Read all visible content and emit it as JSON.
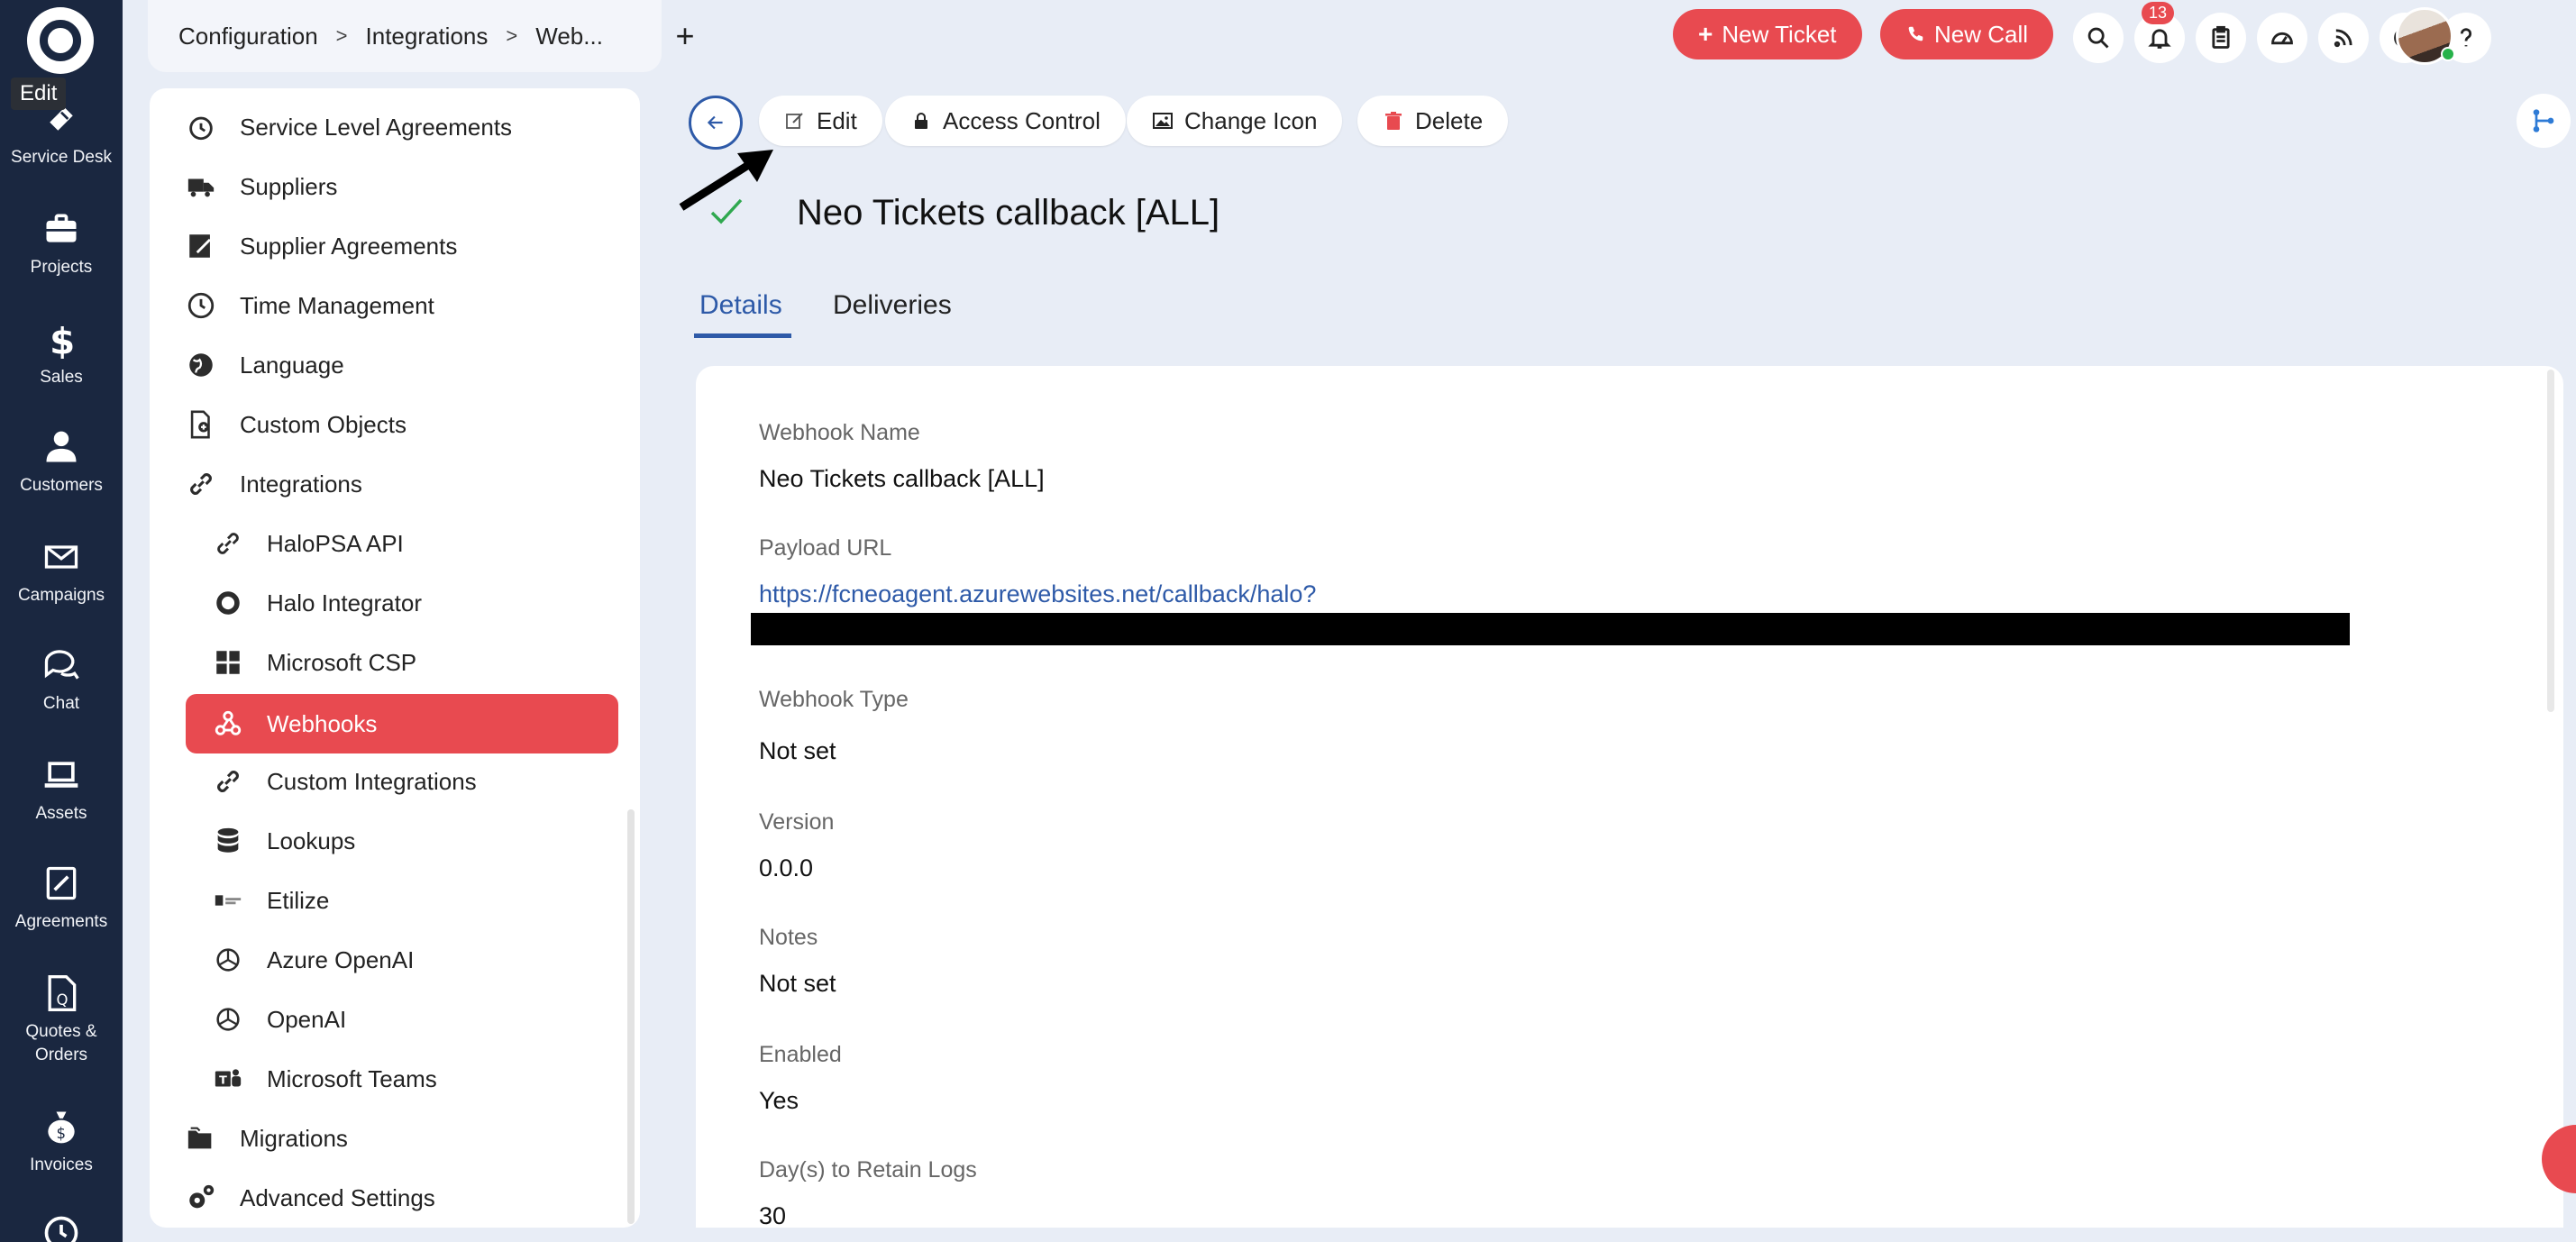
{
  "rail": {
    "tooltip": "Edit",
    "items": [
      {
        "label": "Service Desk",
        "icon": "ticket-icon"
      },
      {
        "label": "Projects",
        "icon": "briefcase-icon"
      },
      {
        "label": "Sales",
        "icon": "dollar-icon"
      },
      {
        "label": "Customers",
        "icon": "person-icon"
      },
      {
        "label": "Campaigns",
        "icon": "envelope-icon"
      },
      {
        "label": "Chat",
        "icon": "chat-bubbles-icon"
      },
      {
        "label": "Assets",
        "icon": "laptop-icon"
      },
      {
        "label": "Agreements",
        "icon": "signed-document-icon"
      },
      {
        "label": "Quotes &",
        "label2": "Orders",
        "icon": "quote-document-icon"
      },
      {
        "label": "Invoices",
        "icon": "money-bag-icon"
      }
    ]
  },
  "breadcrumb": {
    "items": [
      "Configuration",
      "Integrations",
      "Web..."
    ],
    "separator": ">"
  },
  "topbar": {
    "new_tab": "+",
    "new_ticket": "New Ticket",
    "new_call": "New Call",
    "notification_count": "13",
    "accent": "#e84a50"
  },
  "sidebar": {
    "items": [
      {
        "label": "Service Level Agreements",
        "icon": "timer-icon"
      },
      {
        "label": "Suppliers",
        "icon": "truck-icon"
      },
      {
        "label": "Supplier Agreements",
        "icon": "edit-document-icon"
      },
      {
        "label": "Time Management",
        "icon": "clock-icon"
      },
      {
        "label": "Language",
        "icon": "globe-icon"
      },
      {
        "label": "Custom Objects",
        "icon": "document-plus-icon"
      },
      {
        "label": "Integrations",
        "icon": "link-icon"
      },
      {
        "label": "HaloPSA API",
        "icon": "api-link-icon"
      },
      {
        "label": "Halo Integrator",
        "icon": "halo-ring-icon"
      },
      {
        "label": "Microsoft CSP",
        "icon": "windows-icon"
      },
      {
        "label": "Webhooks",
        "icon": "webhook-icon"
      },
      {
        "label": "Custom Integrations",
        "icon": "link-icon"
      },
      {
        "label": "Lookups",
        "icon": "database-icon"
      },
      {
        "label": "Etilize",
        "icon": "etilize-logo-icon"
      },
      {
        "label": "Azure OpenAI",
        "icon": "openai-icon"
      },
      {
        "label": "OpenAI",
        "icon": "openai-icon"
      },
      {
        "label": "Microsoft Teams",
        "icon": "teams-icon"
      },
      {
        "label": "Migrations",
        "icon": "folders-icon"
      },
      {
        "label": "Advanced Settings",
        "icon": "gears-icon"
      }
    ]
  },
  "actions": {
    "edit": "Edit",
    "access_control": "Access Control",
    "change_icon": "Change Icon",
    "delete": "Delete"
  },
  "page": {
    "title": "Neo Tickets callback [ALL]"
  },
  "tabs": [
    {
      "label": "Details"
    },
    {
      "label": "Deliveries"
    }
  ],
  "details": {
    "webhook_name_label": "Webhook Name",
    "webhook_name": "Neo Tickets callback [ALL]",
    "payload_url_label": "Payload URL",
    "payload_url": "https://fcneoagent.azurewebsites.net/callback/halo?",
    "webhook_type_label": "Webhook Type",
    "webhook_type": "Not set",
    "version_label": "Version",
    "version": "0.0.0",
    "notes_label": "Notes",
    "notes": "Not set",
    "enabled_label": "Enabled",
    "enabled": "Yes",
    "retain_logs_label": "Day(s) to Retain Logs",
    "retain_logs": "30"
  }
}
